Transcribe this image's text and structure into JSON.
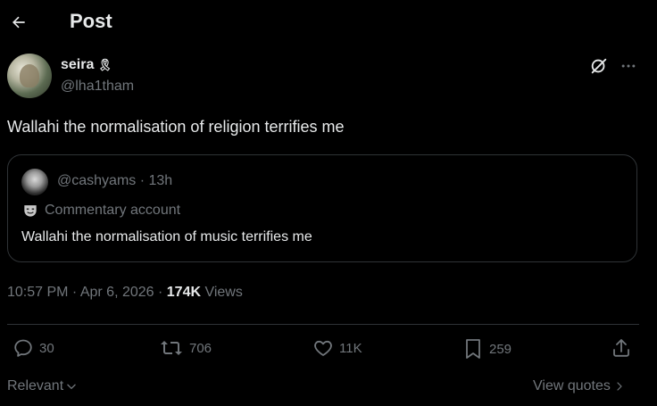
{
  "header": {
    "title": "Post"
  },
  "author": {
    "display_name": "seira",
    "badge_emoji": "🎗",
    "handle": "@lha1tham"
  },
  "tweet": {
    "text": "Wallahi the normalisation of religion terrifies me"
  },
  "quote": {
    "meta": "@cashyams · 13h",
    "badge_label": "Commentary account",
    "text": "Wallahi the normalisation of music terrifies me"
  },
  "meta": {
    "time_date": "10:57 PM · Apr 6, 2026 · ",
    "views_count": "174K",
    "views_label": " Views"
  },
  "actions": {
    "replies": "30",
    "reposts": "706",
    "likes": "11K",
    "bookmarks": "259"
  },
  "footer": {
    "sort_label": "Relevant",
    "view_quotes_label": "View quotes"
  },
  "icons": {
    "back": "arrow-left-icon",
    "grok": "grok-icon",
    "more": "more-horizontal-icon",
    "reply": "reply-icon",
    "repost": "repost-icon",
    "like": "heart-icon",
    "bookmark": "bookmark-icon",
    "share": "share-icon",
    "badge": "mask-icon"
  }
}
